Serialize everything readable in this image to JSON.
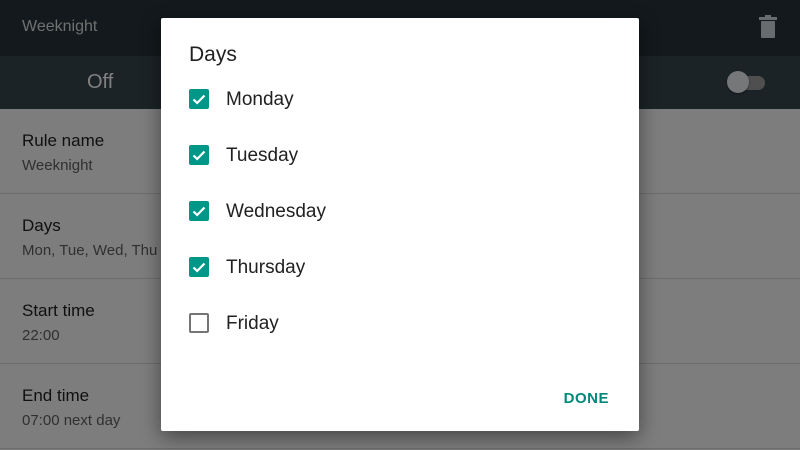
{
  "appbar": {
    "title": "Weeknight"
  },
  "switchbar": {
    "label": "Off"
  },
  "settings": [
    {
      "title": "Rule name",
      "value": "Weeknight"
    },
    {
      "title": "Days",
      "value": "Mon, Tue, Wed, Thu"
    },
    {
      "title": "Start time",
      "value": "22:00"
    },
    {
      "title": "End time",
      "value": "07:00 next day"
    }
  ],
  "dialog": {
    "title": "Days",
    "options": [
      {
        "label": "Monday",
        "checked": true
      },
      {
        "label": "Tuesday",
        "checked": true
      },
      {
        "label": "Wednesday",
        "checked": true
      },
      {
        "label": "Thursday",
        "checked": true
      },
      {
        "label": "Friday",
        "checked": false
      }
    ],
    "done_label": "DONE"
  },
  "colors": {
    "accent": "#009688",
    "appbar": "#263238",
    "switchbar": "#37474f"
  }
}
